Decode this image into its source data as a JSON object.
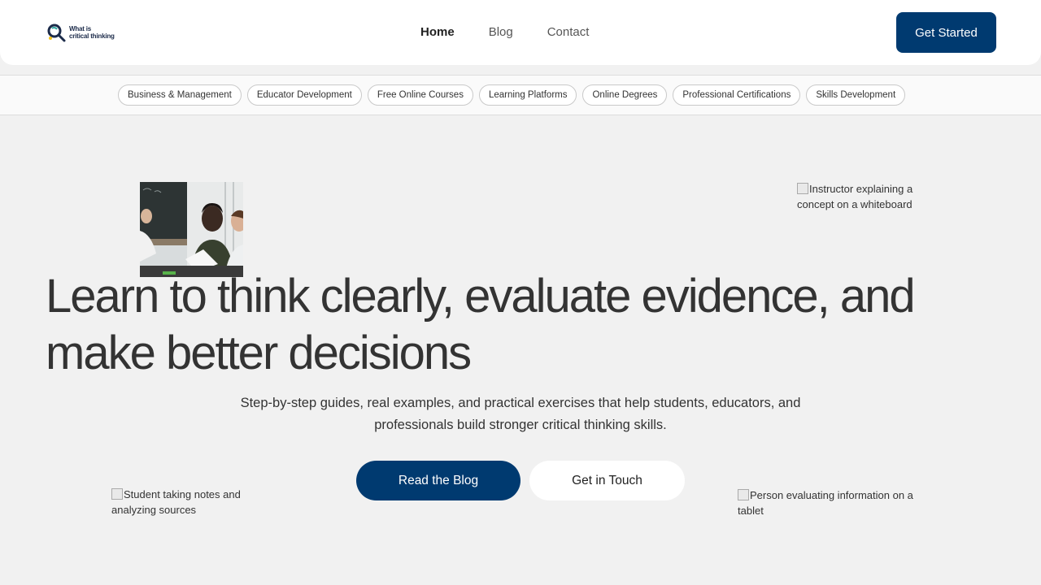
{
  "brand": {
    "logo_line1": "What is",
    "logo_line2": "critical thinking",
    "primary_color": "#003a70"
  },
  "nav": {
    "items": [
      {
        "label": "Home",
        "active": true
      },
      {
        "label": "Blog",
        "active": false
      },
      {
        "label": "Contact",
        "active": false
      }
    ],
    "cta_label": "Get Started"
  },
  "categories": [
    "Business & Management",
    "Educator Development",
    "Free Online Courses",
    "Learning Platforms",
    "Online Degrees",
    "Professional Certifications",
    "Skills Development"
  ],
  "hero": {
    "title": "Learn to think clearly, evaluate evidence, and make better decisions",
    "subtitle": "Step-by-step guides, real examples, and practical exercises that help students, educators, and professionals build stronger critical thinking skills.",
    "primary_button": "Read the Blog",
    "secondary_button": "Get in Touch"
  },
  "images": {
    "instructor_alt": "Instructor explaining a concept on a whiteboard",
    "student_alt": "Student taking notes and analyzing sources",
    "tablet_alt": "Person evaluating information on a tablet"
  }
}
